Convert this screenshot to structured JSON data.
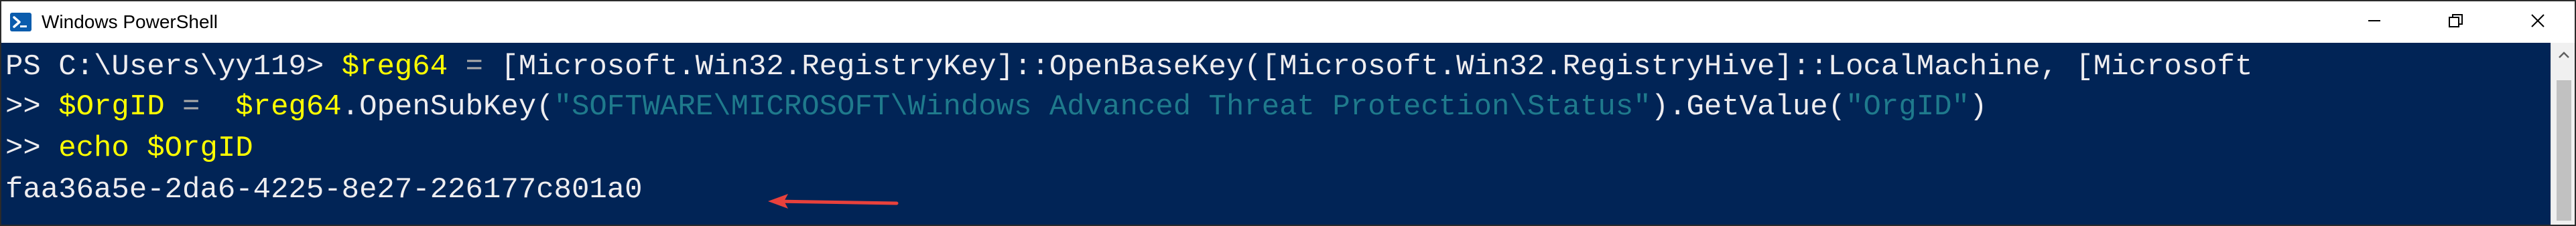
{
  "window": {
    "title": "Windows PowerShell",
    "icon": "powershell-icon",
    "controls": {
      "minimize_icon": "minimize-icon",
      "maximize_icon": "restore-icon",
      "close_icon": "close-icon"
    }
  },
  "console": {
    "background": "#012456",
    "lines": [
      {
        "prompt": "PS C:\\Users\\yy119> ",
        "var": "$reg64",
        "op": " = ",
        "rest": "[Microsoft.Win32.RegistryKey]::OpenBaseKey([Microsoft.Win32.RegistryHive]::LocalMachine, [Microsoft"
      },
      {
        "prompt": ">> ",
        "var1": "$OrgID",
        "op": " =  ",
        "var2": "$reg64",
        "method": ".OpenSubKey(",
        "string1": "\"SOFTWARE\\MICROSOFT\\Windows Advanced Threat Protection\\Status\"",
        "method2": ").GetValue(",
        "string2": "\"OrgID\"",
        "close": ")"
      },
      {
        "prompt": ">> ",
        "cmd": "echo",
        "space": " ",
        "var": "$OrgID"
      },
      {
        "output": "faa36a5e-2da6-4225-8e27-226177c801a0"
      }
    ]
  },
  "annotation": {
    "arrow_color": "#e8413c",
    "arrow_icon": "left-arrow-icon"
  },
  "colors": {
    "variable": "#ffff00",
    "string": "#1f7a8c",
    "text": "#eeedf0"
  }
}
